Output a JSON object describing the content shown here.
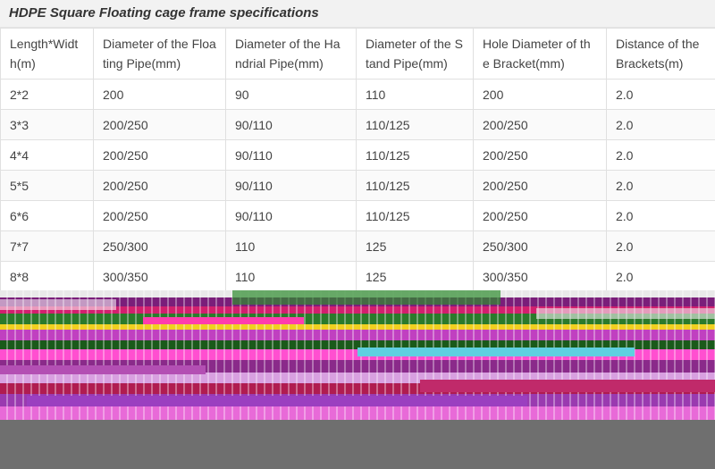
{
  "title": "HDPE Square Floating cage frame specifications",
  "colors": {
    "title_background": "#f2f2f2",
    "border": "#e0e0e0",
    "text": "#444444",
    "bottom_band": "#6f6f6f"
  },
  "table": {
    "headers": [
      "Length*Width(m)",
      "Diameter of the Floating Pipe(mm)",
      "Diameter of the Handrial Pipe(mm)",
      "Diameter of the Stand Pipe(mm)",
      "Hole Diameter of the Bracket(mm)",
      "Distance of the Brackets(m)"
    ],
    "rows": [
      [
        "2*2",
        "200",
        "90",
        "110",
        "200",
        "2.0"
      ],
      [
        "3*3",
        "200/250",
        "90/110",
        "110/125",
        "200/250",
        "2.0"
      ],
      [
        "4*4",
        "200/250",
        "90/110",
        "110/125",
        "200/250",
        "2.0"
      ],
      [
        "5*5",
        "200/250",
        "90/110",
        "110/125",
        "200/250",
        "2.0"
      ],
      [
        "6*6",
        "200/250",
        "90/110",
        "110/125",
        "200/250",
        "2.0"
      ],
      [
        "7*7",
        "250/300",
        "110",
        "125",
        "250/300",
        "2.0"
      ],
      [
        "8*8",
        "300/350",
        "110",
        "125",
        "300/350",
        "2.0"
      ]
    ]
  }
}
